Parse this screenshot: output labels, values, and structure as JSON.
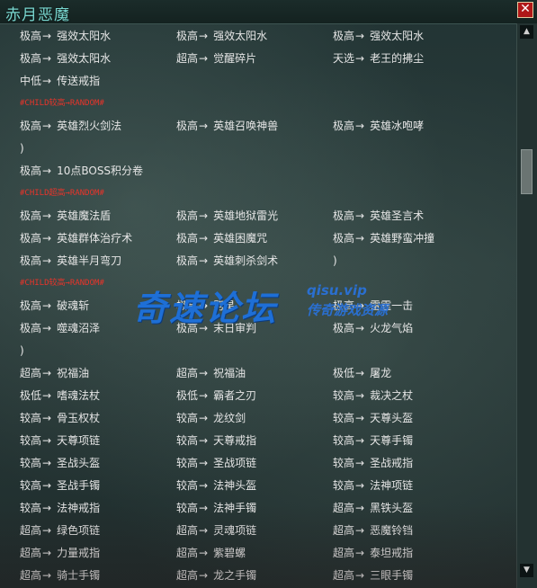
{
  "window": {
    "title": "赤月恶魔",
    "close_label": "✕"
  },
  "arrow": "→",
  "rows": [
    {
      "kind": "items",
      "cells": [
        {
          "g": "极高",
          "n": "强效太阳水"
        },
        {
          "g": "极高",
          "n": "强效太阳水"
        },
        {
          "g": "极高",
          "n": "强效太阳水"
        }
      ]
    },
    {
      "kind": "items",
      "cells": [
        {
          "g": "极高",
          "n": "强效太阳水"
        },
        {
          "g": "超高",
          "n": "觉醒碎片"
        },
        {
          "g": "天选",
          "n": "老王的拂尘"
        }
      ]
    },
    {
      "kind": "items",
      "cells": [
        {
          "g": "中低",
          "n": "传送戒指"
        }
      ]
    },
    {
      "kind": "tag",
      "text": "#CHILD较高→RANDOM#"
    },
    {
      "kind": "items",
      "cells": [
        {
          "g": "极高",
          "n": "英雄烈火剑法"
        },
        {
          "g": "极高",
          "n": "英雄召唤神兽"
        },
        {
          "g": "极高",
          "n": "英雄冰咆哮"
        }
      ]
    },
    {
      "kind": "paren",
      "text": ")"
    },
    {
      "kind": "items",
      "cells": [
        {
          "g": "极高",
          "n": "10点BOSS积分卷"
        }
      ]
    },
    {
      "kind": "tag",
      "text": "#CHILD超高→RANDOM#"
    },
    {
      "kind": "items",
      "cells": [
        {
          "g": "极高",
          "n": "英雄魔法盾"
        },
        {
          "g": "极高",
          "n": "英雄地狱雷光"
        },
        {
          "g": "极高",
          "n": "英雄圣言术"
        }
      ]
    },
    {
      "kind": "items",
      "cells": [
        {
          "g": "极高",
          "n": "英雄群体治疗术"
        },
        {
          "g": "极高",
          "n": "英雄困魔咒"
        },
        {
          "g": "极高",
          "n": "英雄野蛮冲撞"
        }
      ]
    },
    {
      "kind": "items",
      "cells": [
        {
          "g": "极高",
          "n": "英雄半月弯刀"
        },
        {
          "g": "极高",
          "n": "英雄刺杀剑术"
        },
        {
          "paren": ")"
        }
      ]
    },
    {
      "kind": "tag",
      "text": "#CHILD较高→RANDOM#"
    },
    {
      "kind": "items",
      "cells": [
        {
          "g": "极高",
          "n": "破魂斩"
        },
        {
          "g": "极高",
          "n": "劈星"
        },
        {
          "g": "极高",
          "n": "雷霆一击"
        }
      ]
    },
    {
      "kind": "items",
      "cells": [
        {
          "g": "极高",
          "n": "噬魂沼泽"
        },
        {
          "g": "极高",
          "n": "末日审判"
        },
        {
          "g": "极高",
          "n": "火龙气焰"
        }
      ]
    },
    {
      "kind": "paren",
      "text": ")"
    },
    {
      "kind": "items",
      "cells": [
        {
          "g": "超高",
          "n": "祝福油"
        },
        {
          "g": "超高",
          "n": "祝福油"
        },
        {
          "g": "极低",
          "n": "屠龙"
        }
      ]
    },
    {
      "kind": "items",
      "cells": [
        {
          "g": "极低",
          "n": "嗜魂法杖"
        },
        {
          "g": "极低",
          "n": "霸者之刃"
        },
        {
          "g": "较高",
          "n": "裁决之杖"
        }
      ]
    },
    {
      "kind": "items",
      "cells": [
        {
          "g": "较高",
          "n": "骨玉权杖"
        },
        {
          "g": "较高",
          "n": "龙纹剑"
        },
        {
          "g": "较高",
          "n": "天尊头盔"
        }
      ]
    },
    {
      "kind": "items",
      "cells": [
        {
          "g": "较高",
          "n": "天尊项链"
        },
        {
          "g": "较高",
          "n": "天尊戒指"
        },
        {
          "g": "较高",
          "n": "天尊手镯"
        }
      ]
    },
    {
      "kind": "items",
      "cells": [
        {
          "g": "较高",
          "n": "圣战头盔"
        },
        {
          "g": "较高",
          "n": "圣战项链"
        },
        {
          "g": "较高",
          "n": "圣战戒指"
        }
      ]
    },
    {
      "kind": "items",
      "cells": [
        {
          "g": "较高",
          "n": "圣战手镯"
        },
        {
          "g": "较高",
          "n": "法神头盔"
        },
        {
          "g": "较高",
          "n": "法神项链"
        }
      ]
    },
    {
      "kind": "items",
      "cells": [
        {
          "g": "较高",
          "n": "法神戒指"
        },
        {
          "g": "较高",
          "n": "法神手镯"
        },
        {
          "g": "超高",
          "n": "黑铁头盔"
        }
      ]
    },
    {
      "kind": "items",
      "cells": [
        {
          "g": "超高",
          "n": "绿色项链"
        },
        {
          "g": "超高",
          "n": "灵魂项链"
        },
        {
          "g": "超高",
          "n": "恶魔铃铛"
        }
      ]
    },
    {
      "kind": "items",
      "cells": [
        {
          "g": "超高",
          "n": "力量戒指"
        },
        {
          "g": "超高",
          "n": "紫碧螺"
        },
        {
          "g": "超高",
          "n": "泰坦戒指"
        }
      ]
    },
    {
      "kind": "items",
      "cells": [
        {
          "g": "超高",
          "n": "骑士手镯"
        },
        {
          "g": "超高",
          "n": "龙之手镯"
        },
        {
          "g": "超高",
          "n": "三眼手镯"
        }
      ]
    }
  ],
  "watermark": {
    "brand": "奇速论坛",
    "url": "qisu.vip",
    "sub": "传奇游戏资源"
  }
}
